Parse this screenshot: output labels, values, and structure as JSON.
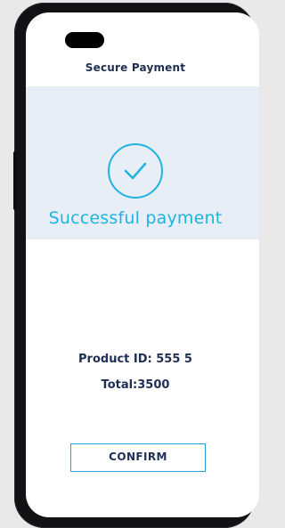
{
  "header": {
    "title": "Secure Payment"
  },
  "status": {
    "message": "Successful payment",
    "icon": "check-circle-icon",
    "accent_color": "#1fb3e0"
  },
  "details": {
    "product_id": "Product ID: 555 5",
    "total": "Total:3500"
  },
  "actions": {
    "confirm_label": "CONFIRM"
  }
}
